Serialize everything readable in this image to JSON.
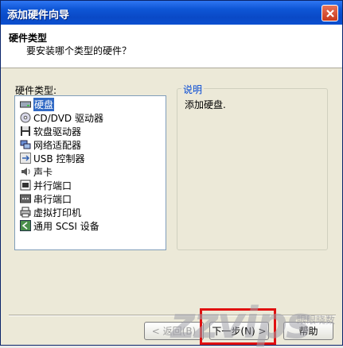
{
  "window": {
    "title": "添加硬件向导"
  },
  "header": {
    "title": "硬件类型",
    "subtitle": "要安装哪个类型的硬件？"
  },
  "left": {
    "label": "硬件类型:",
    "items": [
      {
        "label": "硬盘",
        "icon": "hard-disk-icon",
        "selected": true
      },
      {
        "label": "CD/DVD 驱动器",
        "icon": "cd-dvd-icon"
      },
      {
        "label": "软盘驱动器",
        "icon": "floppy-icon"
      },
      {
        "label": "网络适配器",
        "icon": "network-adapter-icon"
      },
      {
        "label": "USB 控制器",
        "icon": "usb-icon"
      },
      {
        "label": "声卡",
        "icon": "sound-card-icon"
      },
      {
        "label": "并行端口",
        "icon": "parallel-port-icon"
      },
      {
        "label": "串行端口",
        "icon": "serial-port-icon"
      },
      {
        "label": "虚拟打印机",
        "icon": "printer-icon"
      },
      {
        "label": "通用 SCSI 设备",
        "icon": "scsi-icon"
      }
    ]
  },
  "description": {
    "title": "说明",
    "text": "添加硬盘."
  },
  "buttons": {
    "back": "< 返回(B)",
    "next": "下一步(N) >",
    "help": "帮助"
  },
  "watermark": {
    "text": "zzvips",
    "sub": "眼眼晓数"
  }
}
